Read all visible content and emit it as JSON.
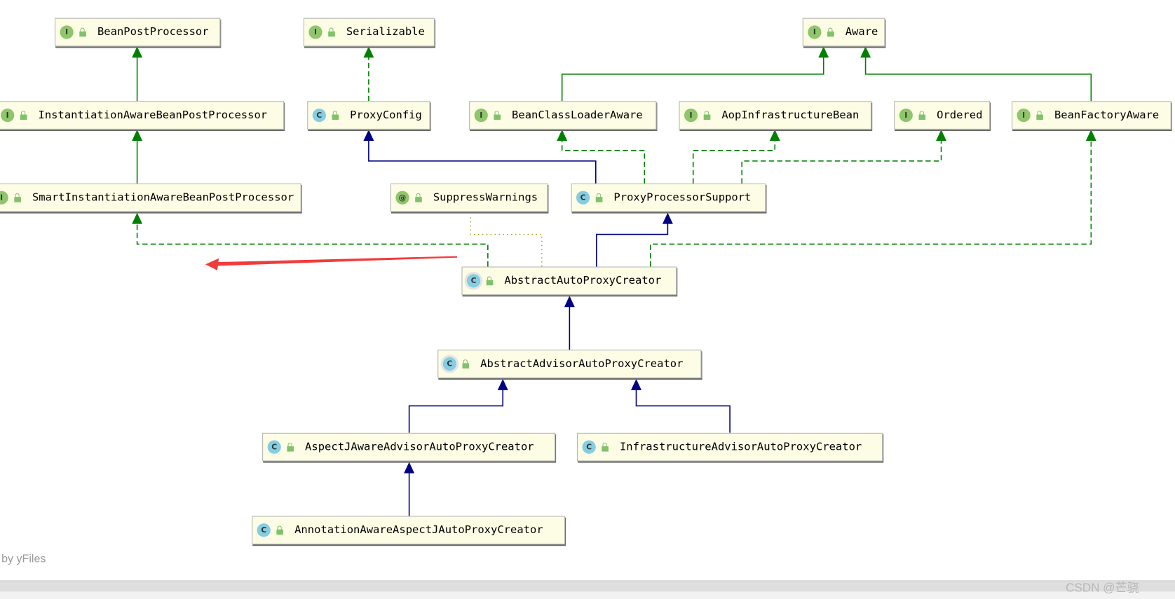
{
  "nodes": [
    {
      "id": "bpp",
      "label": "BeanPostProcessor",
      "kind": "interface",
      "badge": "I"
    },
    {
      "id": "ser",
      "label": "Serializable",
      "kind": "interface",
      "badge": "I"
    },
    {
      "id": "aware",
      "label": "Aware",
      "kind": "interface",
      "badge": "I"
    },
    {
      "id": "iabpp",
      "label": "InstantiationAwareBeanPostProcessor",
      "kind": "interface",
      "badge": "I"
    },
    {
      "id": "pc",
      "label": "ProxyConfig",
      "kind": "class",
      "badge": "C"
    },
    {
      "id": "bcla",
      "label": "BeanClassLoaderAware",
      "kind": "interface",
      "badge": "I"
    },
    {
      "id": "aib",
      "label": "AopInfrastructureBean",
      "kind": "interface",
      "badge": "I"
    },
    {
      "id": "ord",
      "label": "Ordered",
      "kind": "interface",
      "badge": "I"
    },
    {
      "id": "bfa",
      "label": "BeanFactoryAware",
      "kind": "interface",
      "badge": "I"
    },
    {
      "id": "siabpp",
      "label": "SmartInstantiationAwareBeanPostProcessor",
      "kind": "interface",
      "badge": "I"
    },
    {
      "id": "sw",
      "label": "SuppressWarnings",
      "kind": "annotation",
      "badge": "@"
    },
    {
      "id": "pps",
      "label": "ProxyProcessorSupport",
      "kind": "class",
      "badge": "C"
    },
    {
      "id": "aapc",
      "label": "AbstractAutoProxyCreator",
      "kind": "abstract",
      "badge": "C"
    },
    {
      "id": "aaapc",
      "label": "AbstractAdvisorAutoProxyCreator",
      "kind": "abstract",
      "badge": "C"
    },
    {
      "id": "ajaapc",
      "label": "AspectJAwareAdvisorAutoProxyCreator",
      "kind": "class",
      "badge": "C"
    },
    {
      "id": "iaapc",
      "label": "InfrastructureAdvisorAutoProxyCreator",
      "kind": "class",
      "badge": "C"
    },
    {
      "id": "aaajapc",
      "label": "AnnotationAwareAspectJAutoProxyCreator",
      "kind": "class",
      "badge": "C"
    }
  ],
  "edges": [
    {
      "from": "iabpp",
      "to": "bpp",
      "type": "extends-interface"
    },
    {
      "from": "siabpp",
      "to": "iabpp",
      "type": "extends-interface"
    },
    {
      "from": "pc",
      "to": "ser",
      "type": "implements"
    },
    {
      "from": "bcla",
      "to": "aware",
      "type": "extends-interface"
    },
    {
      "from": "bfa",
      "to": "aware",
      "type": "extends-interface"
    },
    {
      "from": "pps",
      "to": "pc",
      "type": "extends-class"
    },
    {
      "from": "pps",
      "to": "bcla",
      "type": "implements"
    },
    {
      "from": "pps",
      "to": "aib",
      "type": "implements"
    },
    {
      "from": "pps",
      "to": "ord",
      "type": "implements"
    },
    {
      "from": "aapc",
      "to": "siabpp",
      "type": "implements"
    },
    {
      "from": "aapc",
      "to": "sw",
      "type": "annotated"
    },
    {
      "from": "aapc",
      "to": "pps",
      "type": "extends-class"
    },
    {
      "from": "aapc",
      "to": "bfa",
      "type": "implements"
    },
    {
      "from": "aaapc",
      "to": "aapc",
      "type": "extends-class"
    },
    {
      "from": "ajaapc",
      "to": "aaapc",
      "type": "extends-class"
    },
    {
      "from": "iaapc",
      "to": "aaapc",
      "type": "extends-class"
    },
    {
      "from": "aaajapc",
      "to": "ajaapc",
      "type": "extends-class"
    }
  ],
  "colors": {
    "interface_edge": "#008000",
    "class_edge": "#000080",
    "annotation_edge": "#a0a020",
    "highlight_arrow": "#f03c3c",
    "node_bg": "#fdfde6"
  },
  "footer": {
    "credit": "by yFiles",
    "watermark": "CSDN @芒骁"
  }
}
